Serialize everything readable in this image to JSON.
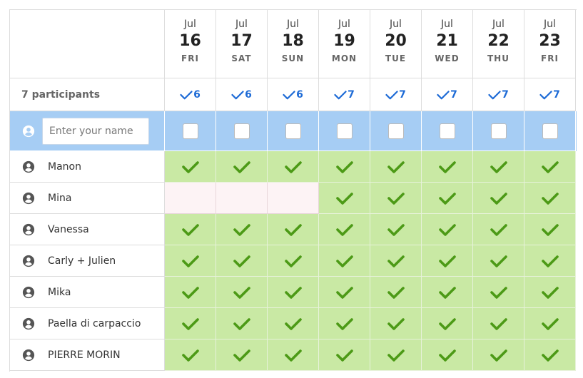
{
  "dates": [
    {
      "month": "Jul",
      "day": "16",
      "dow": "FRI",
      "count": "6"
    },
    {
      "month": "Jul",
      "day": "17",
      "dow": "SAT",
      "count": "6"
    },
    {
      "month": "Jul",
      "day": "18",
      "dow": "SUN",
      "count": "6"
    },
    {
      "month": "Jul",
      "day": "19",
      "dow": "MON",
      "count": "7"
    },
    {
      "month": "Jul",
      "day": "20",
      "dow": "TUE",
      "count": "7"
    },
    {
      "month": "Jul",
      "day": "21",
      "dow": "WED",
      "count": "7"
    },
    {
      "month": "Jul",
      "day": "22",
      "dow": "THU",
      "count": "7"
    },
    {
      "month": "Jul",
      "day": "23",
      "dow": "FRI",
      "count": "7"
    }
  ],
  "participants_label": "7 participants",
  "name_input": {
    "placeholder": "Enter your name",
    "value": ""
  },
  "participants": [
    {
      "name": "Manon",
      "votes": [
        true,
        true,
        true,
        true,
        true,
        true,
        true,
        true
      ]
    },
    {
      "name": "Mina",
      "votes": [
        false,
        false,
        false,
        true,
        true,
        true,
        true,
        true
      ]
    },
    {
      "name": "Vanessa",
      "votes": [
        true,
        true,
        true,
        true,
        true,
        true,
        true,
        true
      ]
    },
    {
      "name": "Carly + Julien",
      "votes": [
        true,
        true,
        true,
        true,
        true,
        true,
        true,
        true
      ]
    },
    {
      "name": "Mika",
      "votes": [
        true,
        true,
        true,
        true,
        true,
        true,
        true,
        true
      ]
    },
    {
      "name": "Paella di carpaccio",
      "votes": [
        true,
        true,
        true,
        true,
        true,
        true,
        true,
        true
      ]
    },
    {
      "name": "PIERRE MORIN",
      "votes": [
        true,
        true,
        true,
        true,
        true,
        true,
        true,
        true
      ]
    }
  ],
  "colors": {
    "yes_bg": "#c9e9a4",
    "yes_check": "#4c9a16",
    "no_bg": "#fdf3f5",
    "count_check": "#1e6bd6",
    "input_row_bg": "#a6cdf4"
  },
  "icons": {
    "participant": "user-circle-icon",
    "yes": "checkmark-icon",
    "count": "checkmark-icon"
  }
}
